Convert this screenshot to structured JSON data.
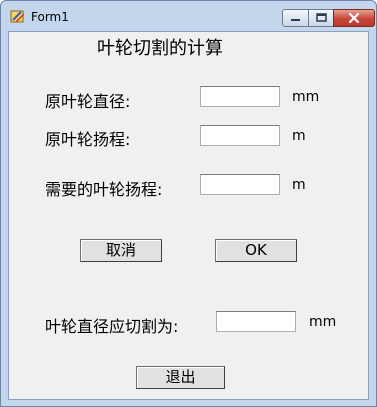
{
  "window": {
    "title": "Form1",
    "buttons": {
      "minimize": "minimize",
      "maximize": "maximize",
      "close": "close"
    }
  },
  "form": {
    "heading": "叶轮切割的计算",
    "rows": [
      {
        "label": "原叶轮直径:",
        "value": "",
        "unit": "mm"
      },
      {
        "label": "原叶轮扬程:",
        "value": "",
        "unit": "m"
      },
      {
        "label": "需要的叶轮扬程:",
        "value": "",
        "unit": "m"
      }
    ],
    "cancel_label": "取消",
    "ok_label": "OK",
    "result": {
      "label": "叶轮直径应切割为:",
      "value": "",
      "unit": "mm"
    },
    "exit_label": "退出"
  },
  "colors": {
    "client_bg": "#f0f0f0",
    "frame": "#c4d6ec",
    "close_button": "#c7463a"
  }
}
